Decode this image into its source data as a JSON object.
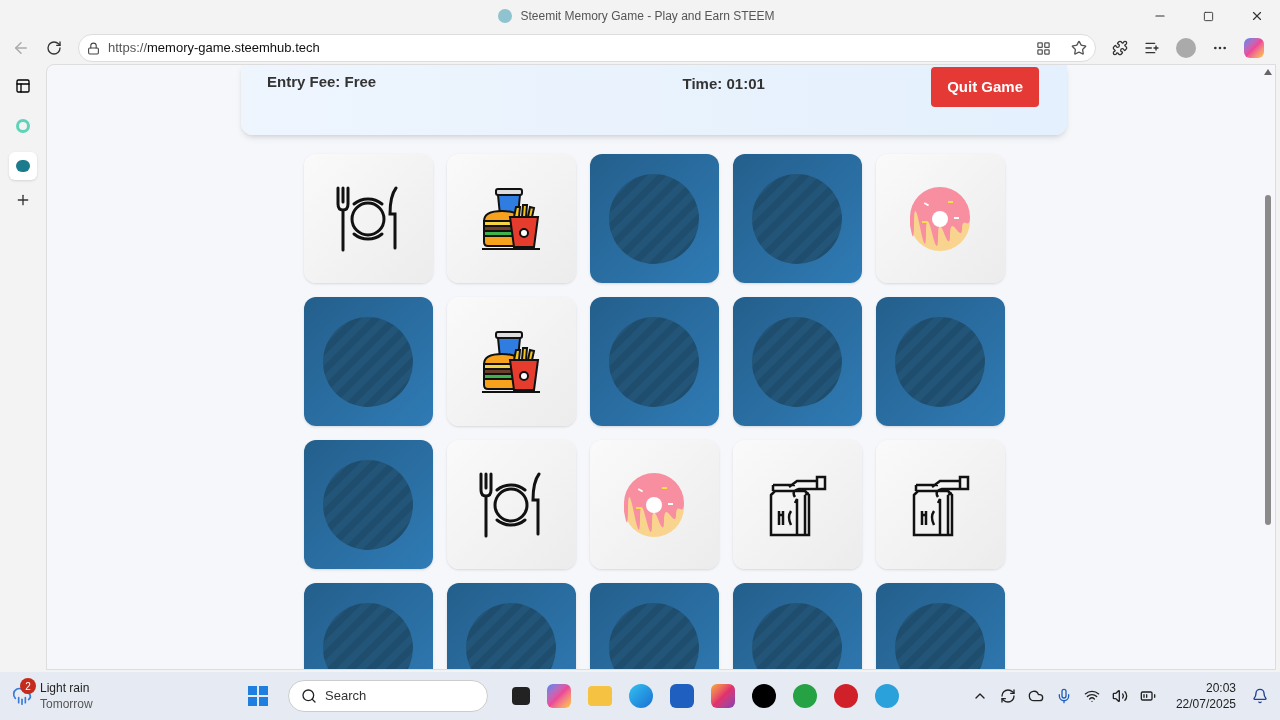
{
  "window": {
    "title": "Steemit Memory Game - Play and Earn STEEM"
  },
  "address_bar": {
    "scheme": "https://",
    "host": "memory-game.steemhub.tech"
  },
  "sidebar": [
    {
      "selected": false
    },
    {
      "selected": false
    },
    {
      "selected": true
    }
  ],
  "game_header": {
    "entry_fee": "Entry Fee: Free",
    "time": "Time: 01:01",
    "quit_button": "Quit Game"
  },
  "cards": [
    {
      "kind": "plate"
    },
    {
      "kind": "meal"
    },
    {
      "kind": "back"
    },
    {
      "kind": "back"
    },
    {
      "kind": "donut"
    },
    {
      "kind": "back"
    },
    {
      "kind": "meal"
    },
    {
      "kind": "back"
    },
    {
      "kind": "back"
    },
    {
      "kind": "back"
    },
    {
      "kind": "back"
    },
    {
      "kind": "plate"
    },
    {
      "kind": "donut"
    },
    {
      "kind": "bag"
    },
    {
      "kind": "bag"
    },
    {
      "kind": "back"
    },
    {
      "kind": "back"
    },
    {
      "kind": "back"
    },
    {
      "kind": "back"
    },
    {
      "kind": "back"
    }
  ],
  "taskbar": {
    "weather_badge": "2",
    "weather": "Light rain",
    "weather_sub": "Tomorrow",
    "search_placeholder": "Search",
    "time": "20:03",
    "date": "22/07/2025"
  }
}
